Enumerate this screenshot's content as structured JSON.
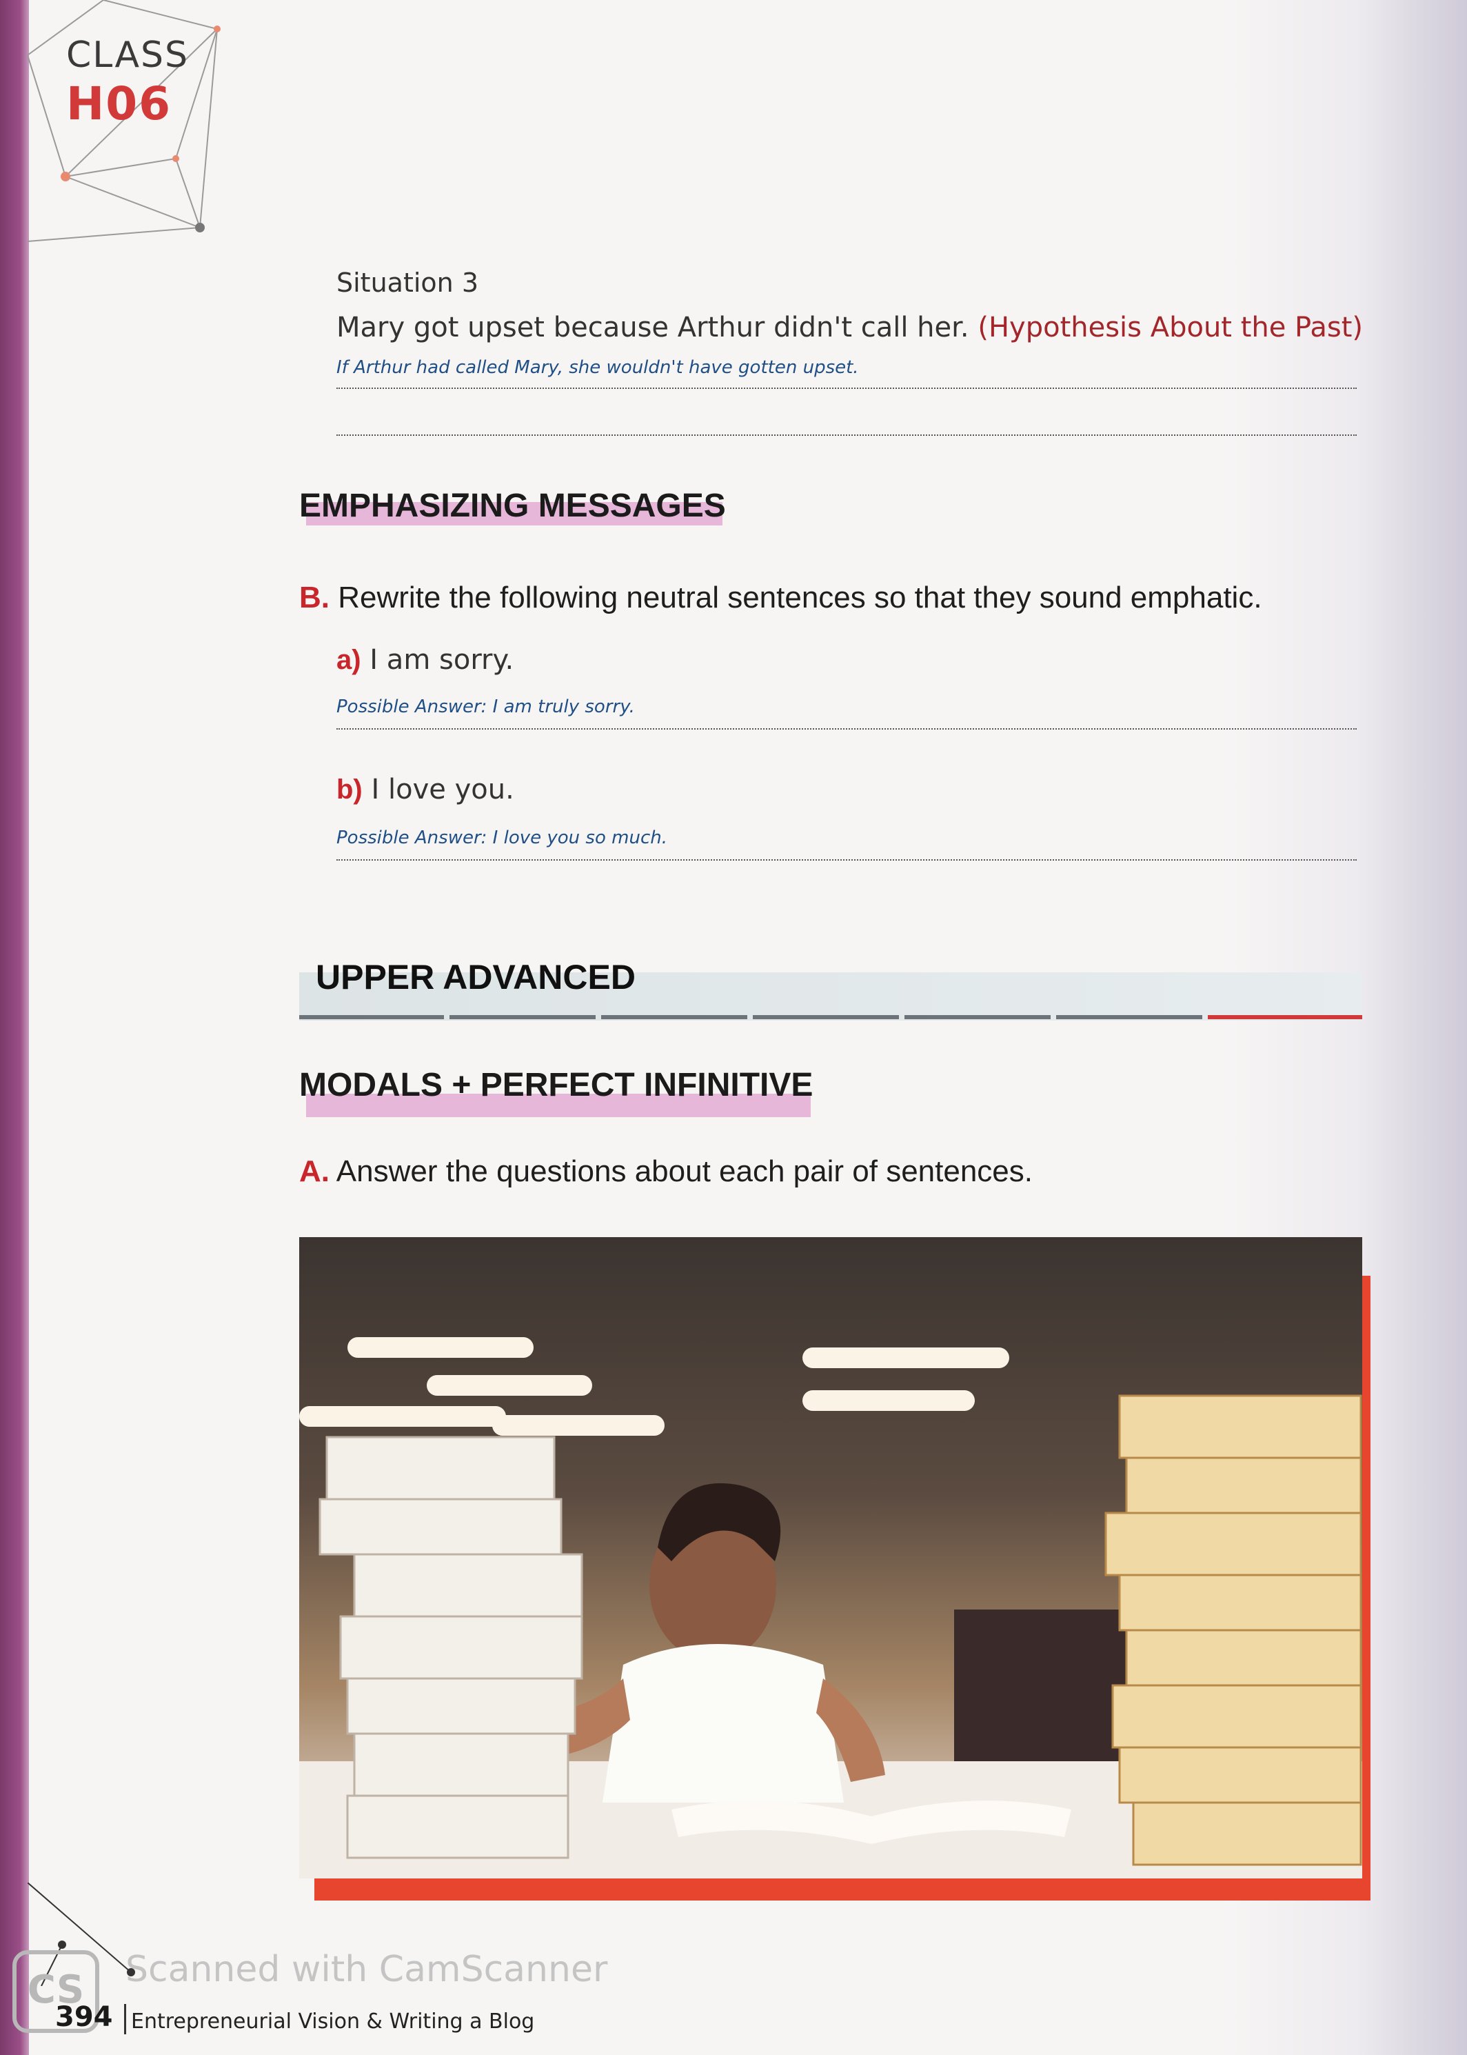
{
  "header": {
    "class_label": "CLASS",
    "class_code": "H06"
  },
  "situation": {
    "title": "Situation 3",
    "sentence": "Mary got upset because Arthur didn't call her.",
    "tag": "(Hypothesis About the Past)",
    "answer": "If Arthur had called Mary, she wouldn't have gotten upset."
  },
  "emphasizing": {
    "heading": "EMPHASIZING MESSAGES",
    "instruction_letter": "B.",
    "instruction": "Rewrite the following neutral sentences so that they sound emphatic.",
    "items": [
      {
        "letter": "a)",
        "text": "I am sorry.",
        "answer": "Possible Answer: I am truly sorry."
      },
      {
        "letter": "b)",
        "text": "I love you.",
        "answer": "Possible Answer: I love you so much."
      }
    ]
  },
  "level": {
    "title": "UPPER ADVANCED"
  },
  "modals": {
    "heading": "MODALS + PERFECT INFINITIVE",
    "instruction_letter": "A.",
    "instruction": "Answer the questions about each pair of sentences."
  },
  "footer": {
    "page_number": "394",
    "book_title": "Entrepreneurial Vision & Writing a Blog",
    "watermark": "Scanned with CamScanner",
    "watermark_logo": "CS"
  },
  "colors": {
    "accent_red": "#c8262b",
    "highlight_pink": "#e6b7d8",
    "answer_blue": "#1f4f86"
  }
}
